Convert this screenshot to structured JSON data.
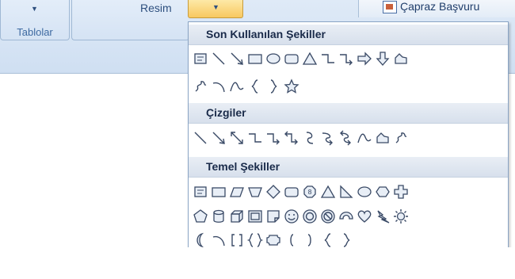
{
  "ribbon": {
    "group_label": "Tablolar",
    "resim_label": "Resim",
    "capraz_label": "Çapraz Başvuru"
  },
  "gallery": {
    "sections": [
      {
        "title": "Son Kullanılan Şekiller"
      },
      {
        "title": "Çizgiler"
      },
      {
        "title": "Temel Şekiller"
      }
    ],
    "recent_row1": [
      "textbox",
      "line",
      "arrow-line",
      "rectangle",
      "oval",
      "rounded-rectangle",
      "triangle",
      "elbow-connector",
      "elbow-arrow",
      "right-arrow",
      "down-arrow",
      "freeform"
    ],
    "recent_row2": [
      "scribble",
      "arc",
      "curve",
      "left-brace",
      "right-brace",
      "star"
    ],
    "lines_row": [
      "line",
      "arrow-line",
      "double-arrow-line",
      "elbow-connector",
      "elbow-arrow",
      "elbow-double-arrow",
      "curved-connector",
      "curved-arrow",
      "curved-double-arrow",
      "curve",
      "freeform",
      "scribble"
    ],
    "basic_row1": [
      "textbox",
      "rectangle",
      "parallelogram",
      "trapezoid",
      "diamond",
      "rounded-rectangle",
      "octagon",
      "triangle",
      "right-triangle",
      "oval",
      "hexagon",
      "cross"
    ],
    "basic_row2": [
      "pentagon",
      "can",
      "cube",
      "bevel",
      "folded-corner",
      "smiley",
      "donut",
      "no-symbol",
      "block-arc",
      "heart",
      "lightning",
      "sun"
    ],
    "basic_row3": [
      "moon",
      "arc",
      "double-bracket",
      "double-brace",
      "plaque",
      "left-bracket",
      "right-bracket",
      "left-brace",
      "right-brace"
    ]
  }
}
